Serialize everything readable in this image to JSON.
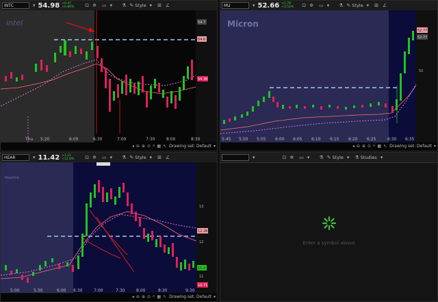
{
  "panes": [
    {
      "symbol": "INTC",
      "price": "54.98",
      "change_top": "+0.47",
      "change_bottom": "+0.86%",
      "logo": "intel",
      "y_ticks": [
        "54.7",
        "54.6",
        "54.38"
      ],
      "x_ticks": [
        "Thu",
        "5:20",
        "6:00",
        "6:30",
        "7:00",
        "7:30",
        "8:00",
        "8:30"
      ],
      "drawing_set": "Drawing set: Default"
    },
    {
      "symbol": "MU",
      "price": "52.66",
      "change_top": "+1.79",
      "change_bottom": "+3.52%",
      "logo": "Micron",
      "y_ticks": [
        "52.77",
        "52.77",
        "52"
      ],
      "x_ticks": [
        "5:45",
        "5:50",
        "5:55",
        "6:00",
        "6:05",
        "6:10",
        "6:15",
        "6:20",
        "6:25",
        "6:30",
        "6:35"
      ],
      "drawing_set": "Drawing set: Default"
    },
    {
      "symbol": "HEAR",
      "price": "11.42",
      "change_top": "+1.21",
      "change_bottom": "+11.8%",
      "logo": "Hearlink",
      "y_ticks": [
        "13",
        "12.28",
        "12",
        "11.2",
        "11",
        "10.71"
      ],
      "x_ticks": [
        "5:00",
        "5:30",
        "6:00",
        "6:30",
        "7:00",
        "7:30",
        "8:00",
        "8:30",
        "9:30"
      ],
      "drawing_set": "Drawing set: Default"
    }
  ],
  "labels": {
    "style": "Style",
    "studies": "Studies"
  },
  "empty_pane": {
    "message": "Enter a symbol above"
  },
  "colors": {
    "up": "#21c521",
    "down": "#e0205a",
    "level_line": "#9cc8ff",
    "afterhours_bg": "#14144a",
    "premarket_bg": "#2b2b2b"
  }
}
